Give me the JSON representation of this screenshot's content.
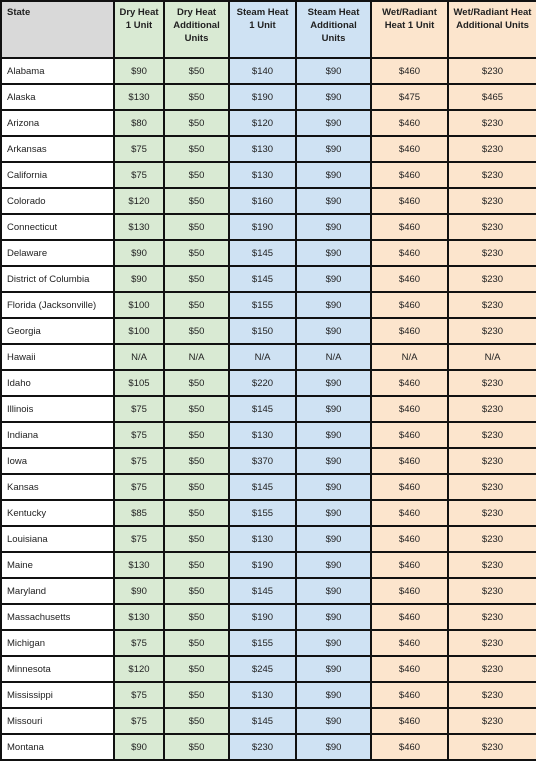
{
  "colors": {
    "header_state_bg": "#d9d9d9",
    "dry_heat_bg": "#d9ead3",
    "steam_heat_bg": "#cfe2f3",
    "wet_radiant_bg": "#fce5cd",
    "border": "#111111"
  },
  "headers": [
    "State",
    "Dry Heat 1 Unit",
    "Dry Heat Additional Units",
    "Steam Heat 1 Unit",
    "Steam Heat Additional Units",
    "Wet/Radiant Heat 1 Unit",
    "Wet/Radiant Heat Additional Units"
  ],
  "rows": [
    [
      "Alabama",
      "$90",
      "$50",
      "$140",
      "$90",
      "$460",
      "$230"
    ],
    [
      "Alaska",
      "$130",
      "$50",
      "$190",
      "$90",
      "$475",
      "$465"
    ],
    [
      "Arizona",
      "$80",
      "$50",
      "$120",
      "$90",
      "$460",
      "$230"
    ],
    [
      "Arkansas",
      "$75",
      "$50",
      "$130",
      "$90",
      "$460",
      "$230"
    ],
    [
      "California",
      "$75",
      "$50",
      "$130",
      "$90",
      "$460",
      "$230"
    ],
    [
      "Colorado",
      "$120",
      "$50",
      "$160",
      "$90",
      "$460",
      "$230"
    ],
    [
      "Connecticut",
      "$130",
      "$50",
      "$190",
      "$90",
      "$460",
      "$230"
    ],
    [
      "Delaware",
      "$90",
      "$50",
      "$145",
      "$90",
      "$460",
      "$230"
    ],
    [
      "District of Columbia",
      "$90",
      "$50",
      "$145",
      "$90",
      "$460",
      "$230"
    ],
    [
      "Florida (Jacksonville)",
      "$100",
      "$50",
      "$155",
      "$90",
      "$460",
      "$230"
    ],
    [
      "Georgia",
      "$100",
      "$50",
      "$150",
      "$90",
      "$460",
      "$230"
    ],
    [
      "Hawaii",
      "N/A",
      "N/A",
      "N/A",
      "N/A",
      "N/A",
      "N/A"
    ],
    [
      "Idaho",
      "$105",
      "$50",
      "$220",
      "$90",
      "$460",
      "$230"
    ],
    [
      "Illinois",
      "$75",
      "$50",
      "$145",
      "$90",
      "$460",
      "$230"
    ],
    [
      "Indiana",
      "$75",
      "$50",
      "$130",
      "$90",
      "$460",
      "$230"
    ],
    [
      "Iowa",
      "$75",
      "$50",
      "$370",
      "$90",
      "$460",
      "$230"
    ],
    [
      "Kansas",
      "$75",
      "$50",
      "$145",
      "$90",
      "$460",
      "$230"
    ],
    [
      "Kentucky",
      "$85",
      "$50",
      "$155",
      "$90",
      "$460",
      "$230"
    ],
    [
      "Louisiana",
      "$75",
      "$50",
      "$130",
      "$90",
      "$460",
      "$230"
    ],
    [
      "Maine",
      "$130",
      "$50",
      "$190",
      "$90",
      "$460",
      "$230"
    ],
    [
      "Maryland",
      "$90",
      "$50",
      "$145",
      "$90",
      "$460",
      "$230"
    ],
    [
      "Massachusetts",
      "$130",
      "$50",
      "$190",
      "$90",
      "$460",
      "$230"
    ],
    [
      "Michigan",
      "$75",
      "$50",
      "$155",
      "$90",
      "$460",
      "$230"
    ],
    [
      "Minnesota",
      "$120",
      "$50",
      "$245",
      "$90",
      "$460",
      "$230"
    ],
    [
      "Mississippi",
      "$75",
      "$50",
      "$130",
      "$90",
      "$460",
      "$230"
    ],
    [
      "Missouri",
      "$75",
      "$50",
      "$145",
      "$90",
      "$460",
      "$230"
    ],
    [
      "Montana",
      "$90",
      "$50",
      "$230",
      "$90",
      "$460",
      "$230"
    ]
  ]
}
